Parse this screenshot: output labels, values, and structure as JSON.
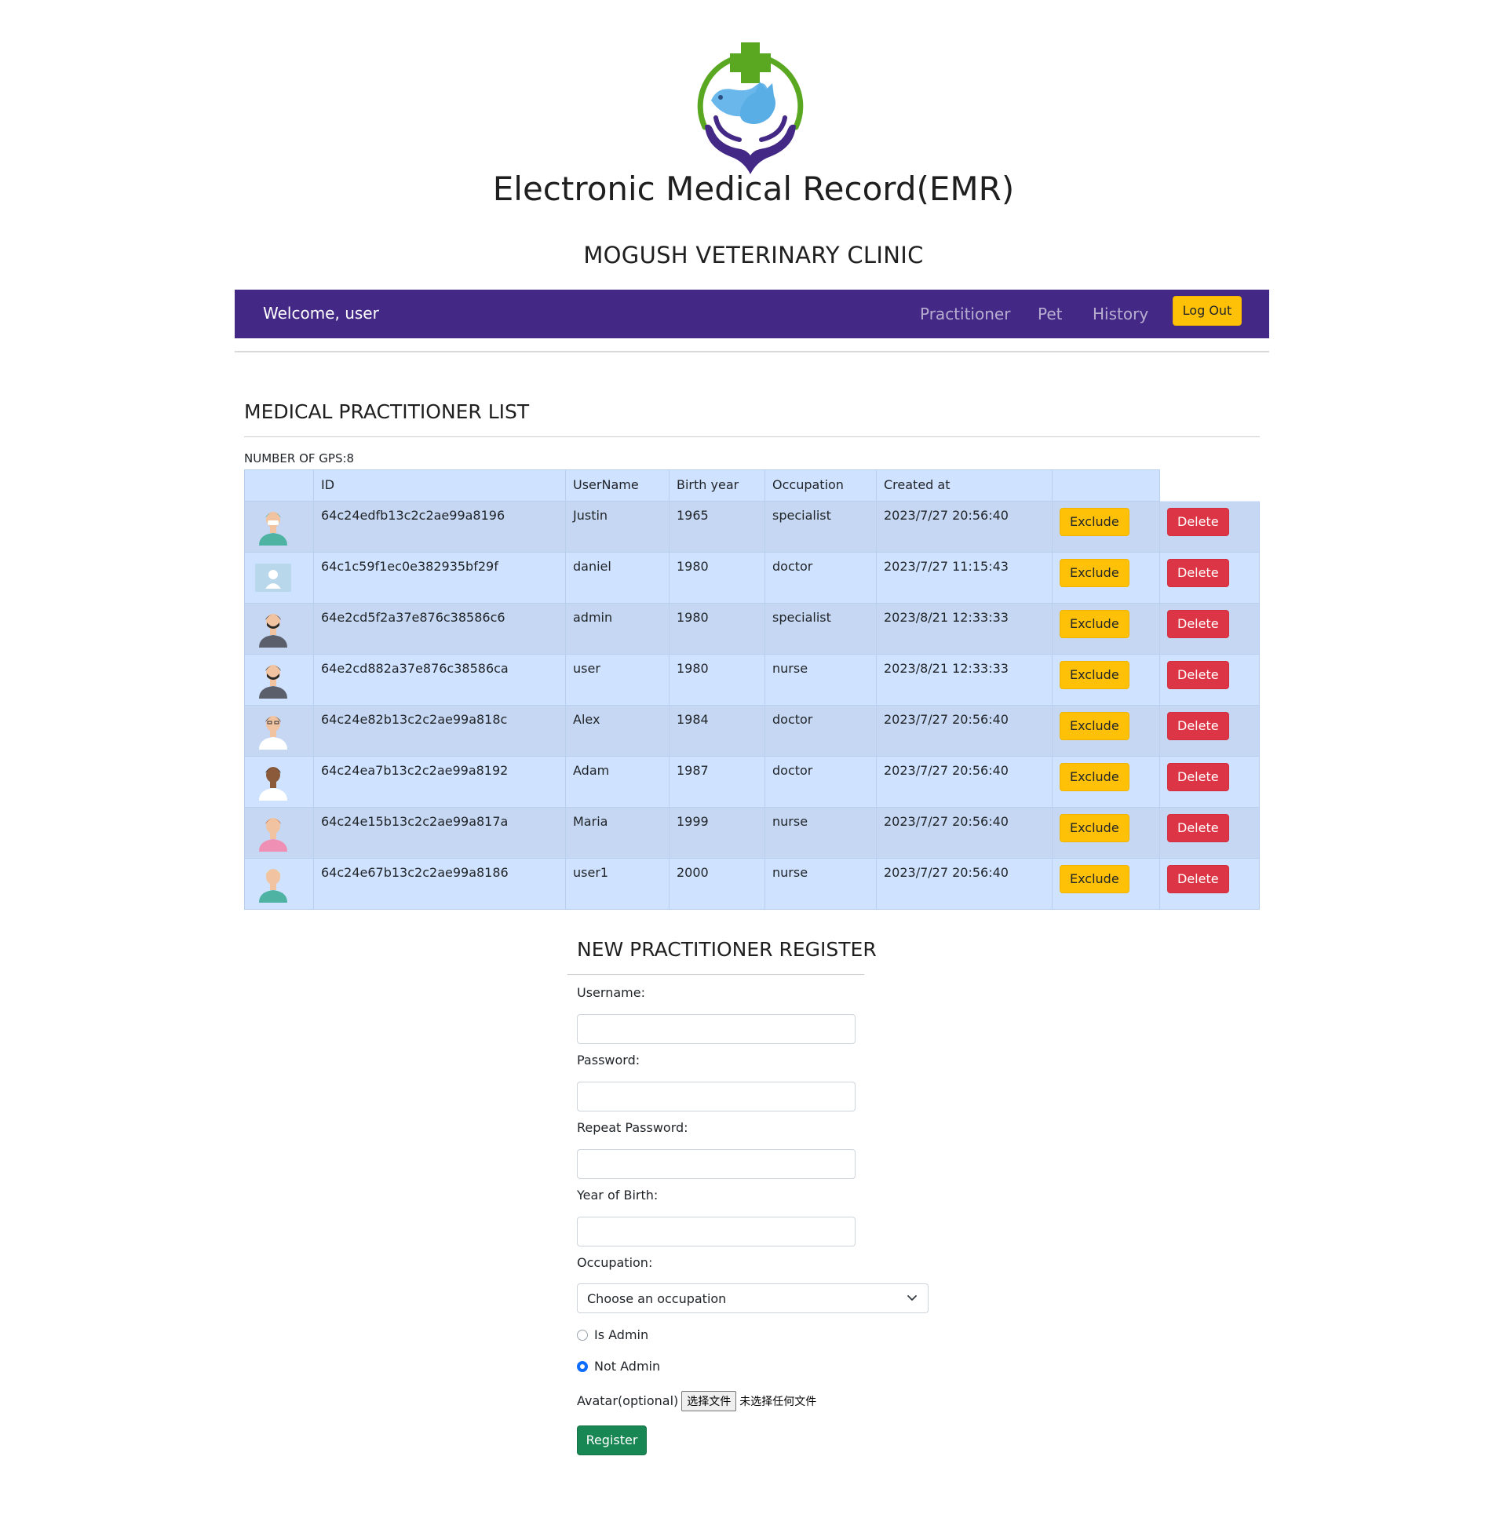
{
  "header": {
    "title": "Electronic Medical Record(EMR)",
    "clinic": "MOGUSH VETERINARY CLINIC"
  },
  "navbar": {
    "welcome": "Welcome, user",
    "links": [
      "Practitioner",
      "Pet",
      "History"
    ],
    "logout": "Log Out",
    "bg_color": "#432985"
  },
  "practitioner_list": {
    "title": "MEDICAL PRACTITIONER LIST",
    "count_label": "NUMBER OF GPS:8",
    "columns": [
      "",
      "ID",
      "UserName",
      "Birth year",
      "Occupation",
      "Created at",
      "",
      ""
    ],
    "exclude_label": "Exclude",
    "delete_label": "Delete",
    "rows": [
      {
        "avatar": "surgeon-avatar-icon",
        "id": "64c24edfb13c2c2ae99a8196",
        "username": "Justin",
        "birth_year": "1965",
        "occupation": "specialist",
        "created_at": "2023/7/27 20:56:40"
      },
      {
        "avatar": "default-user-avatar-icon",
        "id": "64c1c59f1ec0e382935bf29f",
        "username": "daniel",
        "birth_year": "1980",
        "occupation": "doctor",
        "created_at": "2023/7/27 11:15:43"
      },
      {
        "avatar": "bearded-doctor-avatar-icon",
        "id": "64e2cd5f2a37e876c38586c6",
        "username": "admin",
        "birth_year": "1980",
        "occupation": "specialist",
        "created_at": "2023/8/21 12:33:33"
      },
      {
        "avatar": "bearded-doctor-avatar-icon",
        "id": "64e2cd882a37e876c38586ca",
        "username": "user",
        "birth_year": "1980",
        "occupation": "nurse",
        "created_at": "2023/8/21 12:33:33"
      },
      {
        "avatar": "glasses-doctor-avatar-icon",
        "id": "64c24e82b13c2c2ae99a818c",
        "username": "Alex",
        "birth_year": "1984",
        "occupation": "doctor",
        "created_at": "2023/7/27 20:56:40"
      },
      {
        "avatar": "dark-doctor-avatar-icon",
        "id": "64c24ea7b13c2c2ae99a8192",
        "username": "Adam",
        "birth_year": "1987",
        "occupation": "doctor",
        "created_at": "2023/7/27 20:56:40"
      },
      {
        "avatar": "female-nurse-avatar-icon",
        "id": "64c24e15b13c2c2ae99a817a",
        "username": "Maria",
        "birth_year": "1999",
        "occupation": "nurse",
        "created_at": "2023/7/27 20:56:40"
      },
      {
        "avatar": "blonde-nurse-avatar-icon",
        "id": "64c24e67b13c2c2ae99a8186",
        "username": "user1",
        "birth_year": "2000",
        "occupation": "nurse",
        "created_at": "2023/7/27 20:56:40"
      }
    ]
  },
  "register_form": {
    "title": "NEW PRACTITIONER REGISTER",
    "username_label": "Username:",
    "username_value": "",
    "password_label": "Password:",
    "password_value": "",
    "repeat_password_label": "Repeat Password:",
    "repeat_password_value": "",
    "year_of_birth_label": "Year of Birth:",
    "year_of_birth_value": "",
    "occupation_label": "Occupation:",
    "occupation_selected": "Choose an occupation",
    "is_admin_label": "Is Admin",
    "not_admin_label": "Not Admin",
    "selected_admin_option": "Not Admin",
    "avatar_label": "Avatar(optional)",
    "file_button": "选择文件",
    "file_none": "未选择任何文件",
    "register_button": "Register"
  },
  "colors": {
    "exclude": "#ffc107",
    "delete": "#dc3545",
    "register": "#198754",
    "table_bg": "#cfe2ff"
  }
}
